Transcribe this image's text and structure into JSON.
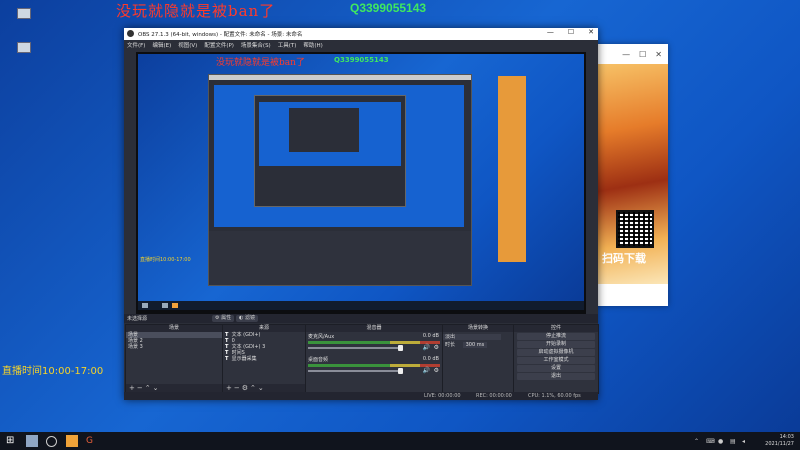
{
  "overlay": {
    "cn_text": "没玩就隐就是被ban了",
    "qq_text": "Q3399055143",
    "live_time": "直播时间10:00-17:00"
  },
  "obs": {
    "title": "OBS 27.1.3 (64-bit, windows) - 配置文件: 未命名 - 场景: 未命名",
    "menu": [
      "文件(F)",
      "编辑(E)",
      "视图(V)",
      "配置文件(P)",
      "场景集合(S)",
      "工具(T)",
      "帮助(H)"
    ],
    "preview_top_label": "未选择源",
    "props_button": "属性",
    "filters_button": "滤镜",
    "scenes_header": "场景",
    "scenes": [
      "场景",
      "场景 2",
      "场景 3"
    ],
    "sources_header": "来源",
    "sources": [
      {
        "icon": "T",
        "label": "文本 (GDI+)"
      },
      {
        "icon": "T",
        "label": "0"
      },
      {
        "icon": "T",
        "label": "文本 (GDI+) 3"
      },
      {
        "icon": "T",
        "label": "时间S"
      },
      {
        "icon": "T",
        "label": "显示器采集"
      }
    ],
    "mixer_header": "混音器",
    "mixer": [
      {
        "name": "麦克风/Aux",
        "db": "0.0 dB"
      },
      {
        "name": "桌面音频",
        "db": "0.0 dB"
      }
    ],
    "transitions_header": "场景转换",
    "transition_type": "淡出",
    "transition_duration_label": "时长",
    "transition_duration": "300 ms",
    "controls_header": "控件",
    "controls": [
      "停止推流",
      "开始录制",
      "启动虚拟摄像机",
      "工作室模式",
      "设置",
      "退出"
    ],
    "status": {
      "live": "LIVE: 00:00:00",
      "rec": "REC: 00:00:00",
      "cpu": "CPU: 1.1%, 60.00 fps"
    }
  },
  "taskbar": {
    "time": "14:03",
    "date": "2021/11/27"
  },
  "banner": {
    "scan_text": "扫码下载"
  },
  "colors": {
    "overlay_red": "#ff3a2a",
    "overlay_green": "#3fe860",
    "overlay_yellow": "#f5d32a",
    "obs_bg": "#2b2e38"
  }
}
